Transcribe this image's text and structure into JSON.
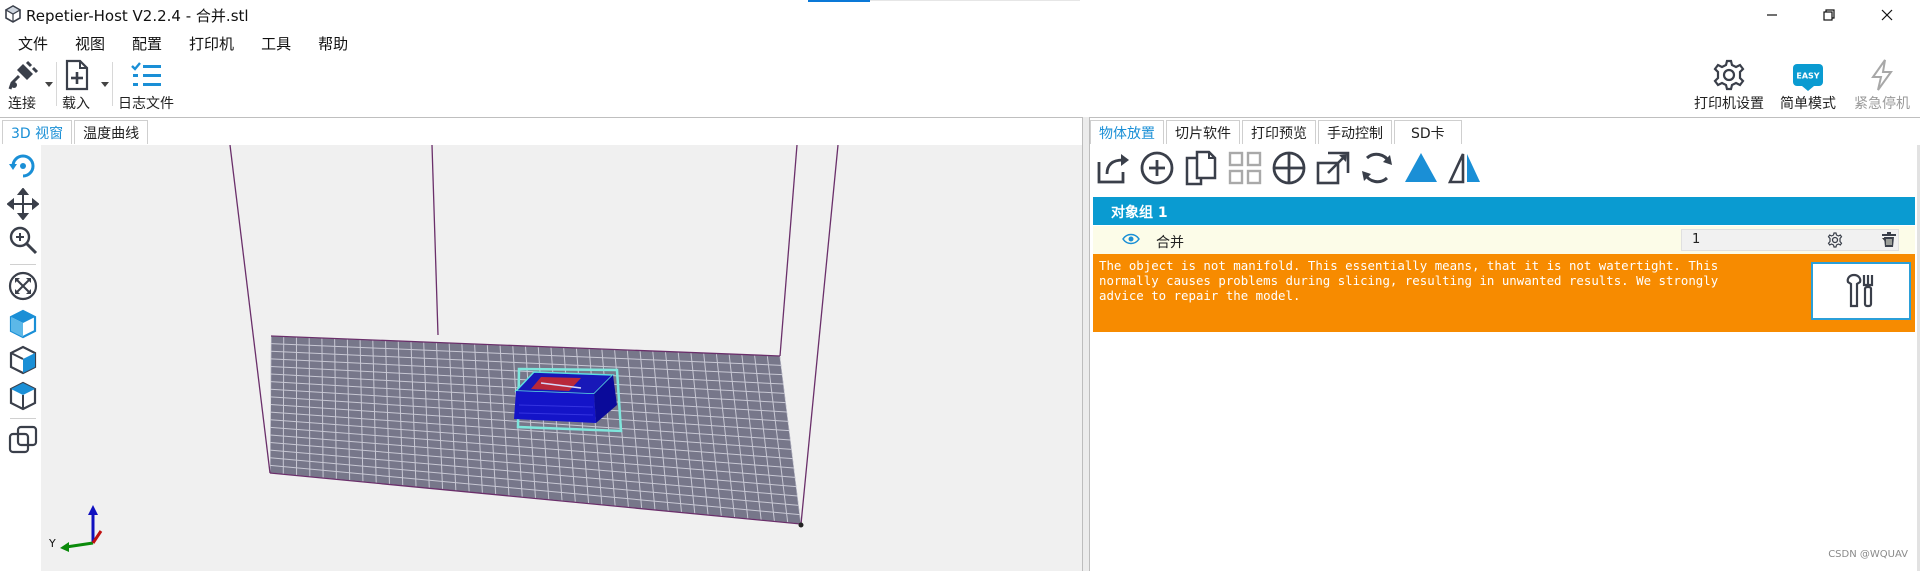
{
  "window": {
    "title": "Repetier-Host V2.2.4 - 合并.stl",
    "controls": [
      "minimize-icon",
      "maximize-icon",
      "close-icon"
    ]
  },
  "menu": [
    "文件",
    "视图",
    "配置",
    "打印机",
    "工具",
    "帮助"
  ],
  "toolbar": {
    "connect": "连接",
    "load": "载入",
    "log": "日志文件",
    "printer_settings": "打印机设置",
    "easy_mode": "简单模式",
    "easy_badge": "EASY",
    "emergency_stop": "紧急停机"
  },
  "left_tabs": [
    "3D 视窗",
    "温度曲线"
  ],
  "right_tabs": [
    "物体放置",
    "切片软件",
    "打印预览",
    "手动控制",
    "SD卡"
  ],
  "viewport": {
    "axis_label": "Y",
    "left_tools": [
      "rotate-icon",
      "move-icon",
      "zoom-icon",
      "fit-view-icon",
      "iso-view-icon",
      "front-view-icon",
      "top-view-icon",
      "parallel-projection-icon"
    ]
  },
  "object_tools": [
    "export-icon",
    "add-object-icon",
    "copy-object-icon",
    "autoposition-icon",
    "center-object-icon",
    "scale-object-icon",
    "rotate-object-icon",
    "land-object-icon",
    "mirror-object-icon"
  ],
  "object_list": {
    "group_name": "对象组 1",
    "objects": [
      {
        "name": "合并",
        "copies": "1",
        "visible": true
      }
    ]
  },
  "warning": {
    "text": "The object is not manifold. This essentially means, that it is not watertight. This\nnormally causes problems during slicing, resulting in unwanted results. We strongly\nadvice to repair the model."
  },
  "watermark": "CSDN @WQUAV",
  "colors": {
    "accent": "#0a9bd1",
    "warning": "#f78b00",
    "row_bg": "#fcfce8",
    "icon_dark": "#3a3f4a",
    "icon_blue": "#1a8fd6",
    "bed_fill": "#77778a"
  }
}
